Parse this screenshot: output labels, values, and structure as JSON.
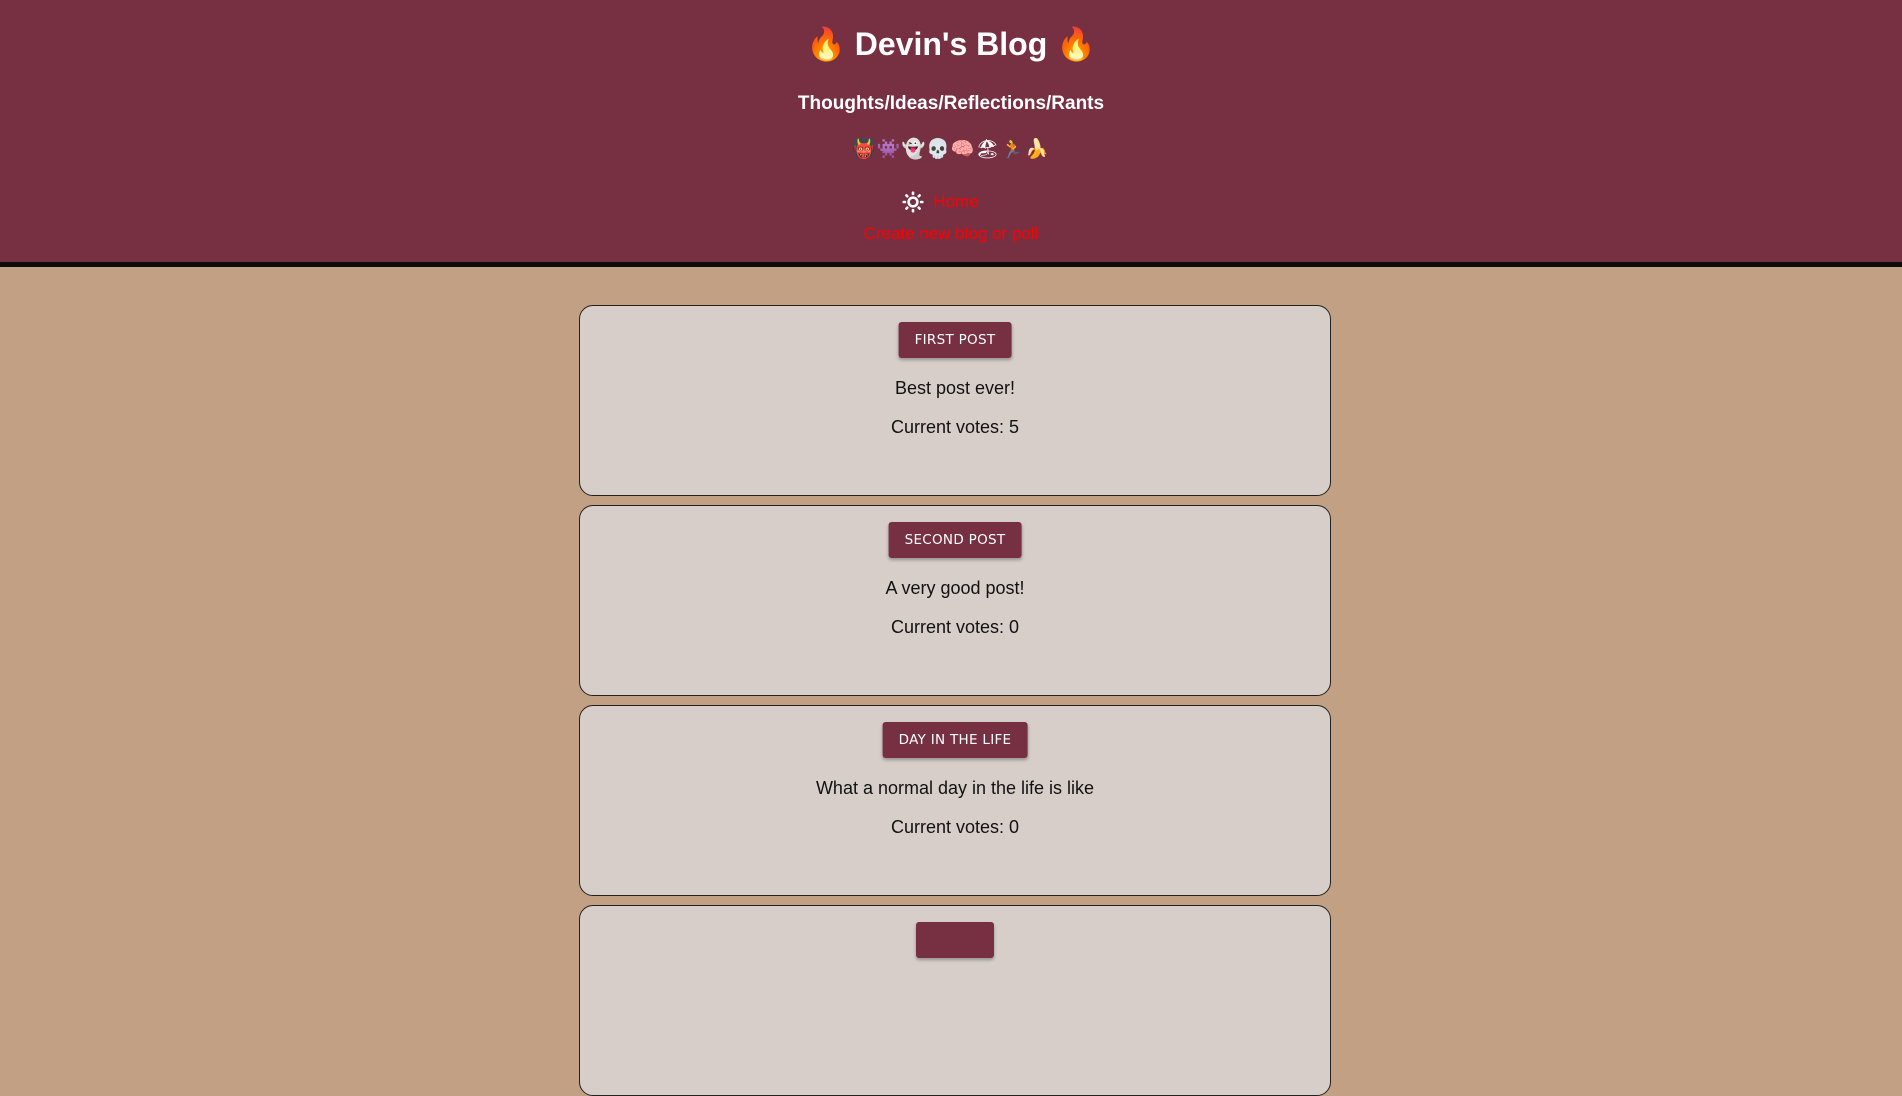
{
  "header": {
    "title": "🔥 Devin's Blog 🔥",
    "subtitle": "Thoughts/Ideas/Reflections/Rants",
    "emojis": "👹👾👻💀🧠🏖🏃🍌",
    "nav": {
      "theme_icon": "sun-icon",
      "home_label": "Home",
      "create_label": "Create new blog or poll"
    },
    "colors": {
      "header_bg": "#772f42",
      "page_bg": "#c1a083",
      "link": "#ff0000",
      "card_bg": "#d7ceca"
    }
  },
  "posts": [
    {
      "title": "First Post",
      "description": "Best post ever!",
      "votes": "Current votes: 5"
    },
    {
      "title": "Second Post",
      "description": "A very good post!",
      "votes": "Current votes: 0"
    },
    {
      "title": "Day in the life",
      "description": "What a normal day in the life is like",
      "votes": "Current votes: 0"
    },
    {
      "title": "",
      "description": "",
      "votes": ""
    }
  ]
}
